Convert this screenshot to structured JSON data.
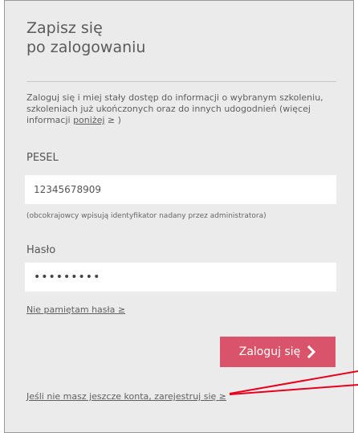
{
  "title": {
    "line1": "Zapisz się",
    "line2": "po zalogowaniu"
  },
  "info": {
    "text": "Zaloguj się i miej stały dostęp do informacji o wybranym szkoleniu, szkoleniach już ukończonych oraz do innych udogodnień (więcej informacji ",
    "link_label": "poniżej",
    "link_suffix": " ≥ )"
  },
  "pesel": {
    "label": "PESEL",
    "value": "12345678909",
    "hint": "(obcokrajowcy wpisują identyfikator nadany przez administratora)"
  },
  "password": {
    "label": "Hasło",
    "value": "•••••••••"
  },
  "forgot_link": "Nie pamiętam hasła",
  "forgot_arrow": "≥",
  "login_button": {
    "label": "Zaloguj się",
    "icon": "chevron-right-icon"
  },
  "register_link": "Jeśli nie masz jeszcze konta, zarejestruj się",
  "register_arrow": "≥",
  "colors": {
    "panel_bg": "#ebebeb",
    "accent": "#d9546a",
    "annotation_line": "#e8001c"
  }
}
